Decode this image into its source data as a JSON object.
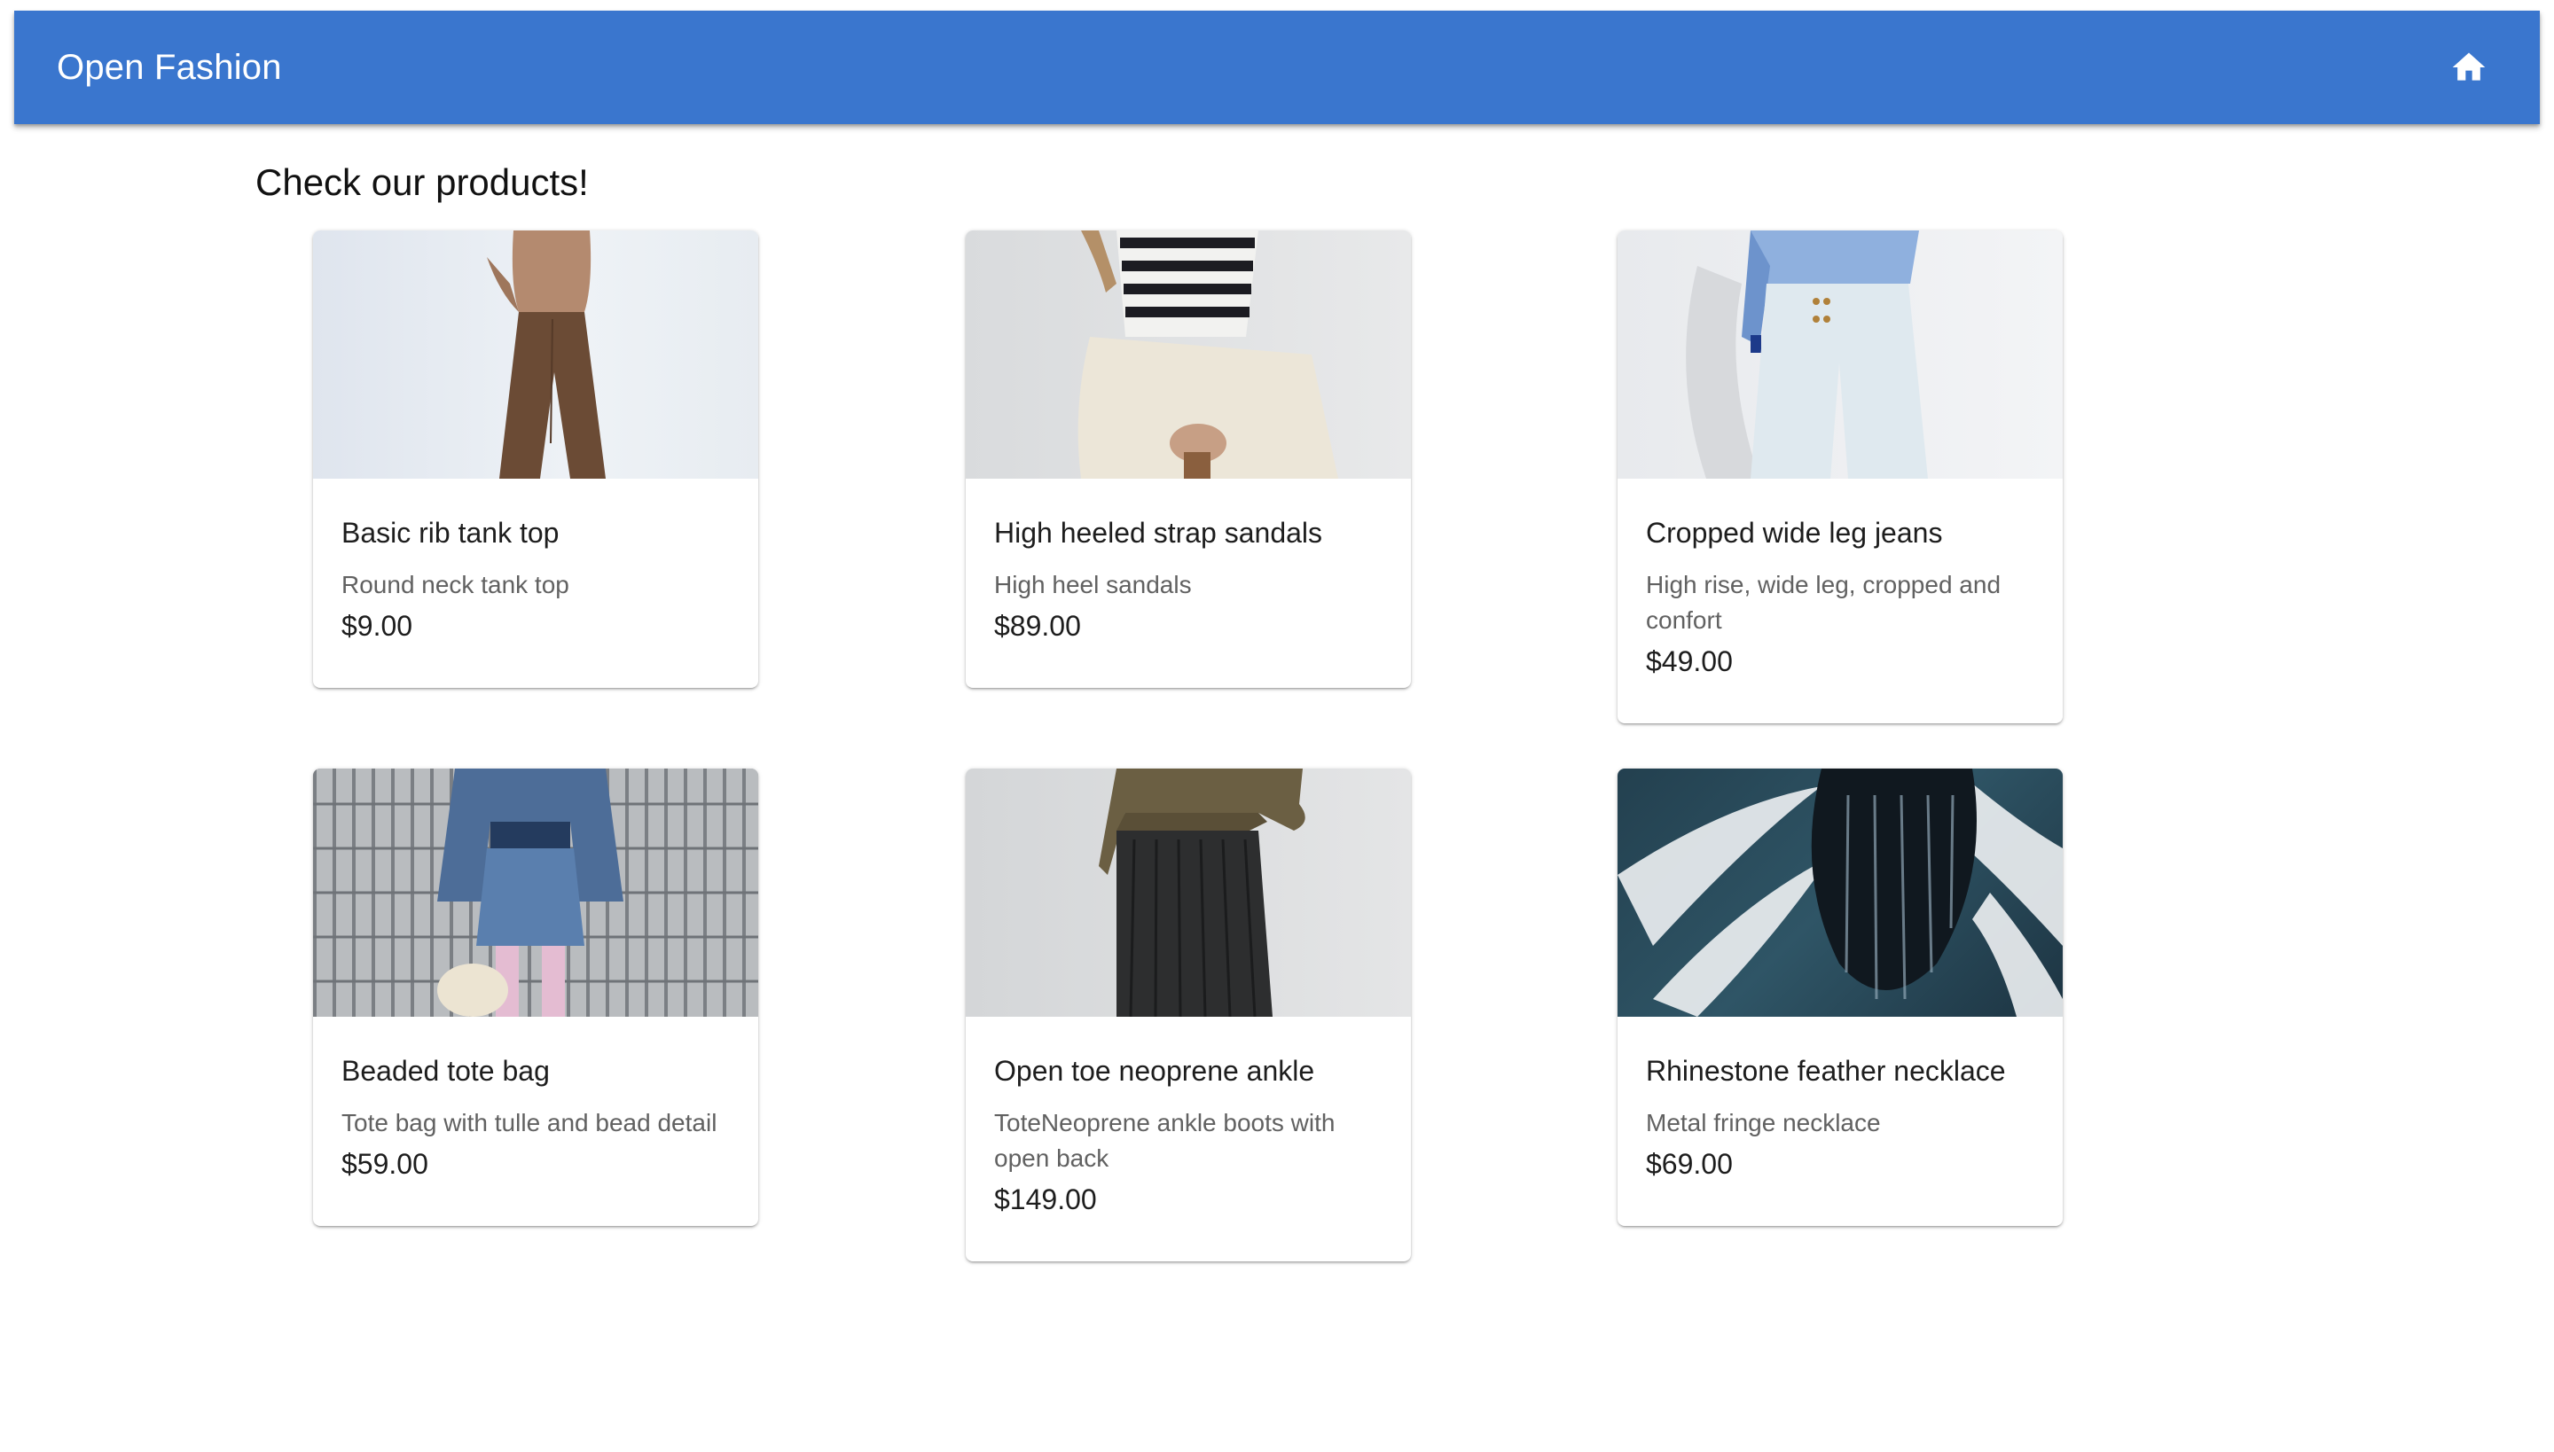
{
  "appbar": {
    "title": "Open Fashion",
    "home_icon": "home-icon",
    "background": "#3a76ce"
  },
  "main": {
    "heading": "Check our products!"
  },
  "products": [
    {
      "name": "Basic rib tank top",
      "description": "Round neck tank top",
      "price": "$9.00"
    },
    {
      "name": "High heeled strap sandals",
      "description": "High heel sandals",
      "price": "$89.00"
    },
    {
      "name": "Cropped wide leg jeans",
      "description": "High rise, wide leg, cropped and confort",
      "price": "$49.00"
    },
    {
      "name": "Beaded tote bag",
      "description": "Tote bag with tulle and bead detail",
      "price": "$59.00"
    },
    {
      "name": "Open toe neoprene ankle",
      "description": "ToteNeoprene ankle boots with open back",
      "price": "$149.00"
    },
    {
      "name": "Rhinestone feather necklace",
      "description": "Metal fringe necklace",
      "price": "$69.00"
    }
  ]
}
